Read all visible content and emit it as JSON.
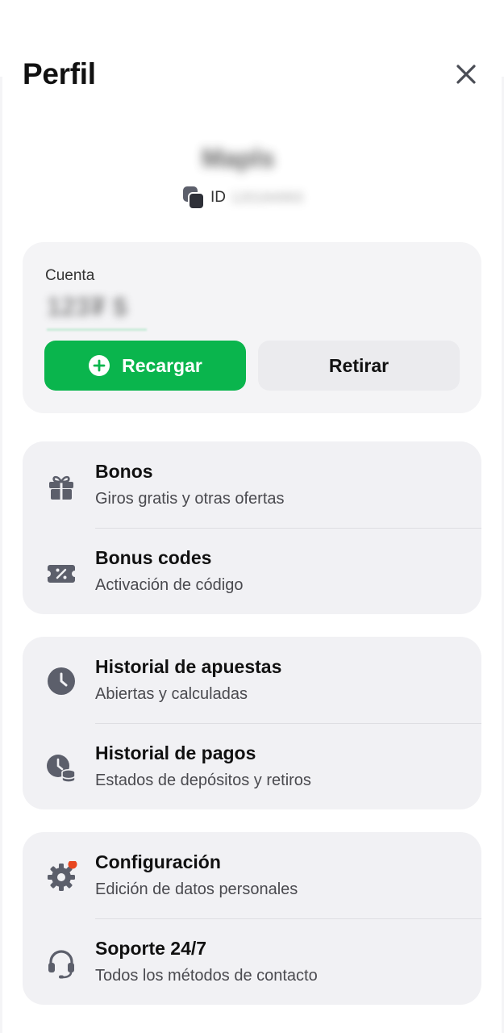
{
  "header": {
    "title": "Perfil"
  },
  "user": {
    "name": "Mapls",
    "id_label": "ID",
    "id_value": "120184993"
  },
  "account": {
    "label": "Cuenta",
    "balance": "123₮ $",
    "recharge_label": "Recargar",
    "withdraw_label": "Retirar"
  },
  "menu_groups": [
    {
      "items": [
        {
          "title": "Bonos",
          "subtitle": "Giros gratis y otras ofertas",
          "icon": "gift-icon"
        },
        {
          "title": "Bonus codes",
          "subtitle": "Activación de código",
          "icon": "promo-ticket-icon"
        }
      ]
    },
    {
      "items": [
        {
          "title": "Historial de apuestas",
          "subtitle": "Abiertas y calculadas",
          "icon": "clock-icon"
        },
        {
          "title": "Historial de pagos",
          "subtitle": "Estados de depósitos y retiros",
          "icon": "payment-history-icon"
        }
      ]
    },
    {
      "items": [
        {
          "title": "Configuración",
          "subtitle": "Edición de datos personales",
          "icon": "gear-icon",
          "notification_dot": true
        },
        {
          "title": "Soporte 24/7",
          "subtitle": "Todos los métodos de contacto",
          "icon": "headset-icon"
        }
      ]
    }
  ],
  "colors": {
    "accent_green": "#0ab54d",
    "card_bg": "#f1f1f4",
    "icon_gray": "#5c5f6b",
    "notification_red": "#e8461f"
  }
}
